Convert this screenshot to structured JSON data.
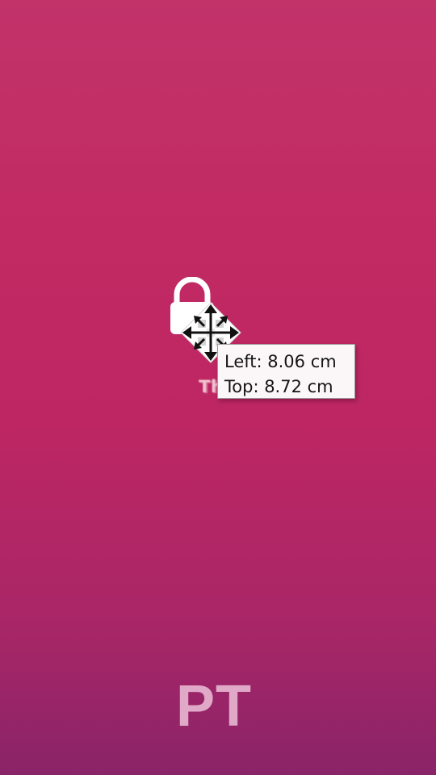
{
  "canvas": {
    "background_top": "#c2336a",
    "background_bottom": "#8a2468"
  },
  "object": {
    "icon": "lock-icon",
    "caption": "This"
  },
  "cursor": {
    "icon": "move-arrows-icon"
  },
  "tooltip": {
    "left": "Left: 8.06 cm",
    "top": "Top: 8.72 cm"
  },
  "watermark": {
    "text": "PT",
    "color": "#ecc1d8"
  }
}
